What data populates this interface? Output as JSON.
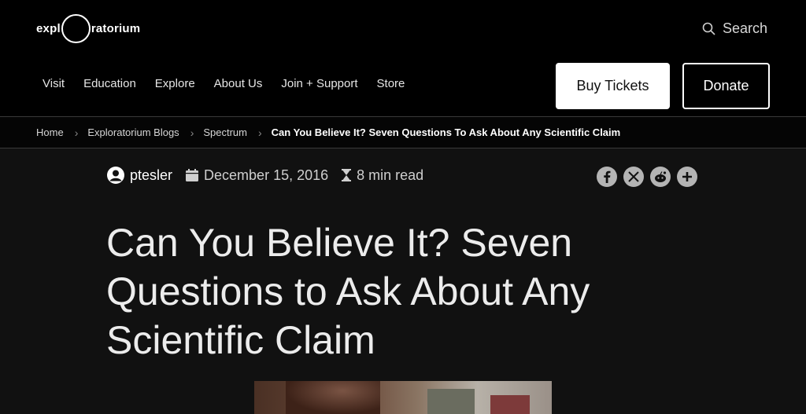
{
  "header": {
    "logo_left": "expl",
    "logo_right": "ratorium",
    "search_label": "Search",
    "nav": [
      "Visit",
      "Education",
      "Explore",
      "About Us",
      "Join + Support",
      "Store"
    ],
    "buy_tickets": "Buy Tickets",
    "donate": "Donate"
  },
  "breadcrumb": {
    "items": [
      "Home",
      "Exploratorium Blogs",
      "Spectrum"
    ],
    "current": "Can You Believe It? Seven Questions To Ask About Any Scientific Claim"
  },
  "article": {
    "author": "ptesler",
    "date": "December 15, 2016",
    "read_time": "8 min read",
    "title": "Can You Believe It? Seven Questions to Ask About Any Scientific Claim",
    "share_icons": [
      "facebook-icon",
      "x-icon",
      "reddit-icon",
      "plus-icon"
    ]
  }
}
